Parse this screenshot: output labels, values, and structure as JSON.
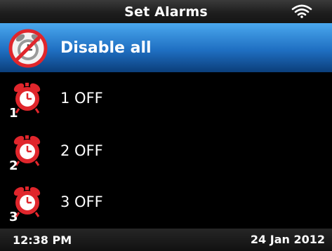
{
  "header": {
    "title": "Set Alarms",
    "icon": "wifi-icon"
  },
  "disable_all": {
    "label": "Disable all",
    "icon": "disabled-alarm-icon"
  },
  "alarms": [
    {
      "number": "1",
      "label": "1 OFF"
    },
    {
      "number": "2",
      "label": "2 OFF"
    },
    {
      "number": "3",
      "label": "3 OFF"
    }
  ],
  "footer": {
    "time": "12:38 PM",
    "date": "24 Jan 2012"
  },
  "colors": {
    "accent": "#2a7fd6",
    "alarm_red": "#e0262c"
  }
}
